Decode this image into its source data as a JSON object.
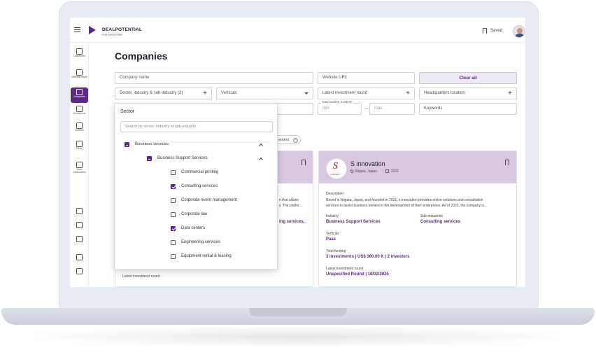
{
  "header": {
    "brand": "DEALPOTENTIAL",
    "brand_sub": "FOR INVESTORS",
    "saved_label": "Saved"
  },
  "sidebar": {
    "items": [
      {
        "label": "Dashboard",
        "icon": "grid-icon"
      },
      {
        "label": "Markets insight",
        "icon": "markets-icon"
      },
      {
        "label": "Companies",
        "icon": "companies-icon"
      },
      {
        "label": "Investments",
        "icon": "investments-icon"
      },
      {
        "label": "Statistics",
        "icon": "statistics-icon"
      },
      {
        "label": "News",
        "icon": "news-icon"
      },
      {
        "label": "Team collaboration",
        "icon": "team-icon"
      }
    ]
  },
  "page": {
    "title": "Companies"
  },
  "filters": {
    "company_name_placeholder": "Company name",
    "website_url_placeholder": "Website URL",
    "clear_all": "Clear all",
    "sector": "Sector, industry & sub-industry (2)",
    "verticals": "Verticals",
    "latest_round": "Latest investment round",
    "hq_location": "Headquarters location",
    "total_funding_label": "Total funding (US$ M)",
    "min_placeholder": "min",
    "max_placeholder": "max",
    "keywords_placeholder": "Keywords",
    "chip_partial": "enters"
  },
  "dropdown": {
    "title": "Sector",
    "search_placeholder": "Search by sector, industry or sub-industry",
    "level1": "Business services",
    "level2": "Business Support Services",
    "options": [
      {
        "label": "Commercial printing",
        "checked": false
      },
      {
        "label": "Consulting services",
        "checked": true
      },
      {
        "label": "Corporate event management",
        "checked": false
      },
      {
        "label": "Corporate law",
        "checked": false
      },
      {
        "label": "Data centers",
        "checked": true
      },
      {
        "label": "Engineering services",
        "checked": false
      },
      {
        "label": "Equipment rental & leasing",
        "checked": false
      }
    ]
  },
  "card_left": {
    "text1": "n that allows",
    "text2": "y. The platfor...",
    "text3": "ing services,",
    "latest_round_label": "Latest investment round"
  },
  "card_right": {
    "name": "S innovation",
    "location": "Niigata, Japan",
    "year": "2021",
    "logo_letter": "S",
    "logo_small": "s innovation",
    "description_label": "Description",
    "description_line1": "Based in Niigata, Japan, and founded in 2021, s innovation provides online solutions and consultation",
    "description_line2": "services to assist business owners in the development of their enterprises. As of 2023, the company is...",
    "industry_label": "Industry",
    "industry": "Business Support Services",
    "subindustries_label": "Sub-industries",
    "subindustries": "Consulting services",
    "verticals_label": "Verticals",
    "verticals": "Paas",
    "total_funding_label": "Total funding",
    "total_funding": "3 investments | US$ 360.00 K | 2 investors",
    "latest_round_label": "Latest investment round",
    "latest_round": "Unspecified Round | 18/02/2025"
  }
}
